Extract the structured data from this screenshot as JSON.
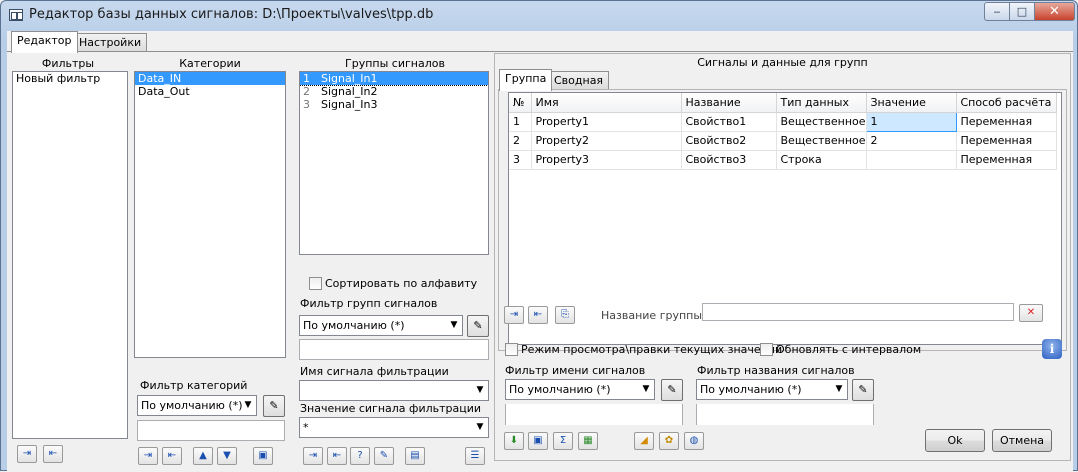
{
  "window": {
    "title": "Редактор базы данных сигналов: D:\\Проекты\\valves\\tpp.db",
    "controls": {
      "minimize": "‒",
      "maximize": "□",
      "close": "✕"
    }
  },
  "tabs": {
    "editor": "Редактор",
    "settings": "Настройки"
  },
  "filters": {
    "header": "Фильтры",
    "items": [
      "Новый фильтр"
    ]
  },
  "categories": {
    "header": "Категории",
    "items": [
      "Data_IN",
      "Data_Out"
    ],
    "selected": "Data_IN",
    "filter_label": "Фильтр категорий",
    "filter_value": "По умолчанию (*)"
  },
  "groups": {
    "header": "Группы сигналов",
    "items": [
      {
        "num": "1",
        "name": "Signal_In1"
      },
      {
        "num": "2",
        "name": "Signal_In2"
      },
      {
        "num": "3",
        "name": "Signal_In3"
      }
    ],
    "sort_label": "Сортировать по алфавиту",
    "filter_label": "Фильтр групп сигналов",
    "filter_value": "По умолчанию (*)",
    "signal_name_label": "Имя сигнала фильтрации",
    "signal_value_label": "Значение сигнала фильтрации",
    "signal_value": "*"
  },
  "signals": {
    "header": "Сигналы и данные для групп",
    "tabs": {
      "group": "Группа",
      "summary": "Сводная"
    },
    "columns": [
      "№",
      "Имя",
      "Название",
      "Тип данных",
      "Значение",
      "Способ расчёта"
    ],
    "rows": [
      [
        "1",
        "Property1",
        "Свойство1",
        "Вещественное",
        "1",
        "Переменная"
      ],
      [
        "2",
        "Property2",
        "Свойство2",
        "Вещественное",
        "2",
        "Переменная"
      ],
      [
        "3",
        "Property3",
        "Свойство3",
        "Строка",
        "",
        "Переменная"
      ]
    ],
    "group_name_label": "Название группы",
    "view_mode_label": "Режим просмотра\\правки текущих значений",
    "update_interval_label": "Обновлять с интервалом",
    "name_filter_label": "Фильтр имени сигналов",
    "name_filter_value": "По умолчанию (*)",
    "title_filter_label": "Фильтр названия сигналов",
    "title_filter_value": "По умолчанию (*)"
  },
  "buttons": {
    "ok": "Ok",
    "cancel": "Отмена"
  },
  "icons": {
    "dropdown": "▼",
    "info": "i",
    "remove": "✕"
  }
}
